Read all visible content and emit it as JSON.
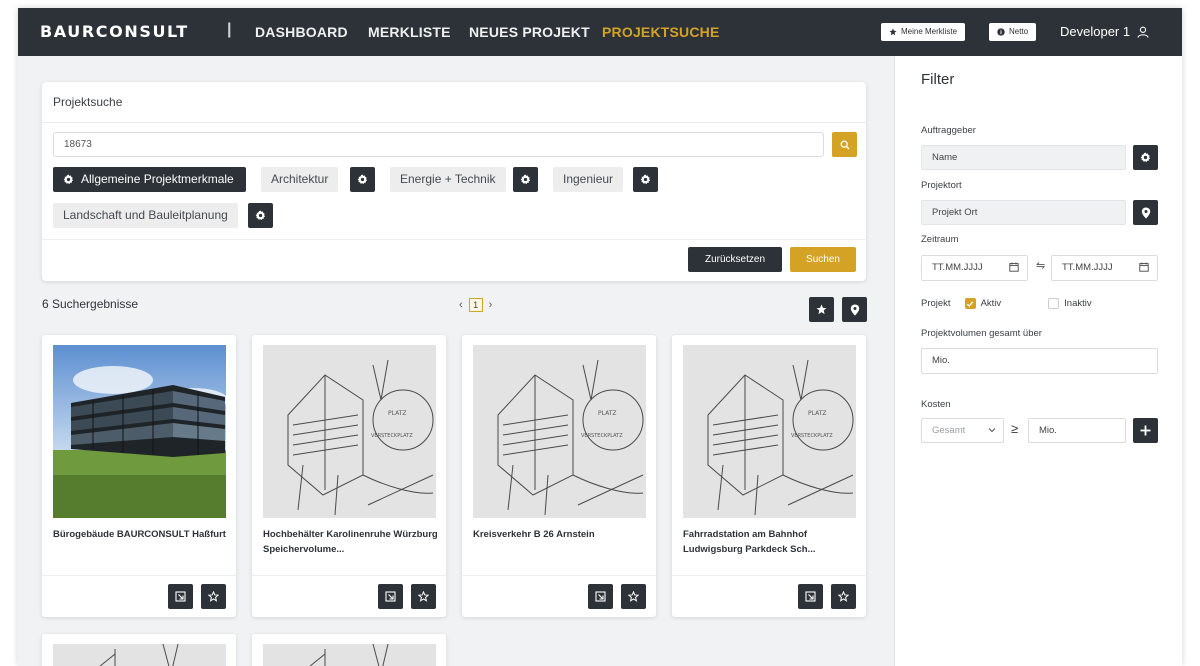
{
  "nav": {
    "brand": "BAURCONSULT",
    "separator": "|",
    "menu": [
      "DASHBOARD",
      "MERKLISTE",
      "NEUES PROJEKT",
      "PROJEKTSUCHE"
    ],
    "active": "PROJEKTSUCHE",
    "pill_merkliste": "Meine Merkliste",
    "pill_netto": "Netto",
    "user": "Developer 1"
  },
  "search": {
    "title": "Projektsuche",
    "value": "18673",
    "categories": [
      "Allgemeine Projektmerkmale",
      "Architektur",
      "Energie + Technik",
      "Ingenieur",
      "Landschaft und Bauleitplanung"
    ],
    "reset_label": "Zurücksetzen",
    "submit_label": "Suchen"
  },
  "results": {
    "count_label": "6 Suchergebnisse",
    "page": "1",
    "prev": "‹",
    "next": "›",
    "cards": [
      {
        "name": "Bürogebäude BAURCONSULT Haßfurt",
        "image": "office-building-photo"
      },
      {
        "name": "Hochbehälter Karolinenruhe Würzburg Speichervolume...",
        "image": "architectural-sketch"
      },
      {
        "name": "Kreisverkehr B 26 Arnstein",
        "image": "architectural-sketch"
      },
      {
        "name": "Fahrradstation am Bahnhof Ludwigsburg Parkdeck Sch...",
        "image": "architectural-sketch"
      }
    ]
  },
  "filter": {
    "title": "Filter",
    "client_label": "Auftraggeber",
    "client_value": "Name",
    "location_label": "Projektort",
    "location_value": "Projekt Ort",
    "period_label": "Zeitraum",
    "date_from": "TT.MM.JJJJ",
    "date_to": "TT.MM.JJJJ",
    "swap_symbol": "⇋",
    "project_label": "Projekt",
    "active_label": "Aktiv",
    "inactive_label": "Inaktiv",
    "active_checked": true,
    "inactive_checked": false,
    "volume_label": "Projektvolumen gesamt über",
    "volume_value": "Mio.",
    "cost_label": "Kosten",
    "cost_select": "Gesamt",
    "cost_operator": "≥",
    "cost_value": "Mio."
  },
  "colors": {
    "nav": "#2d3238",
    "accent": "#d4a326",
    "background": "#f1f2f4"
  }
}
